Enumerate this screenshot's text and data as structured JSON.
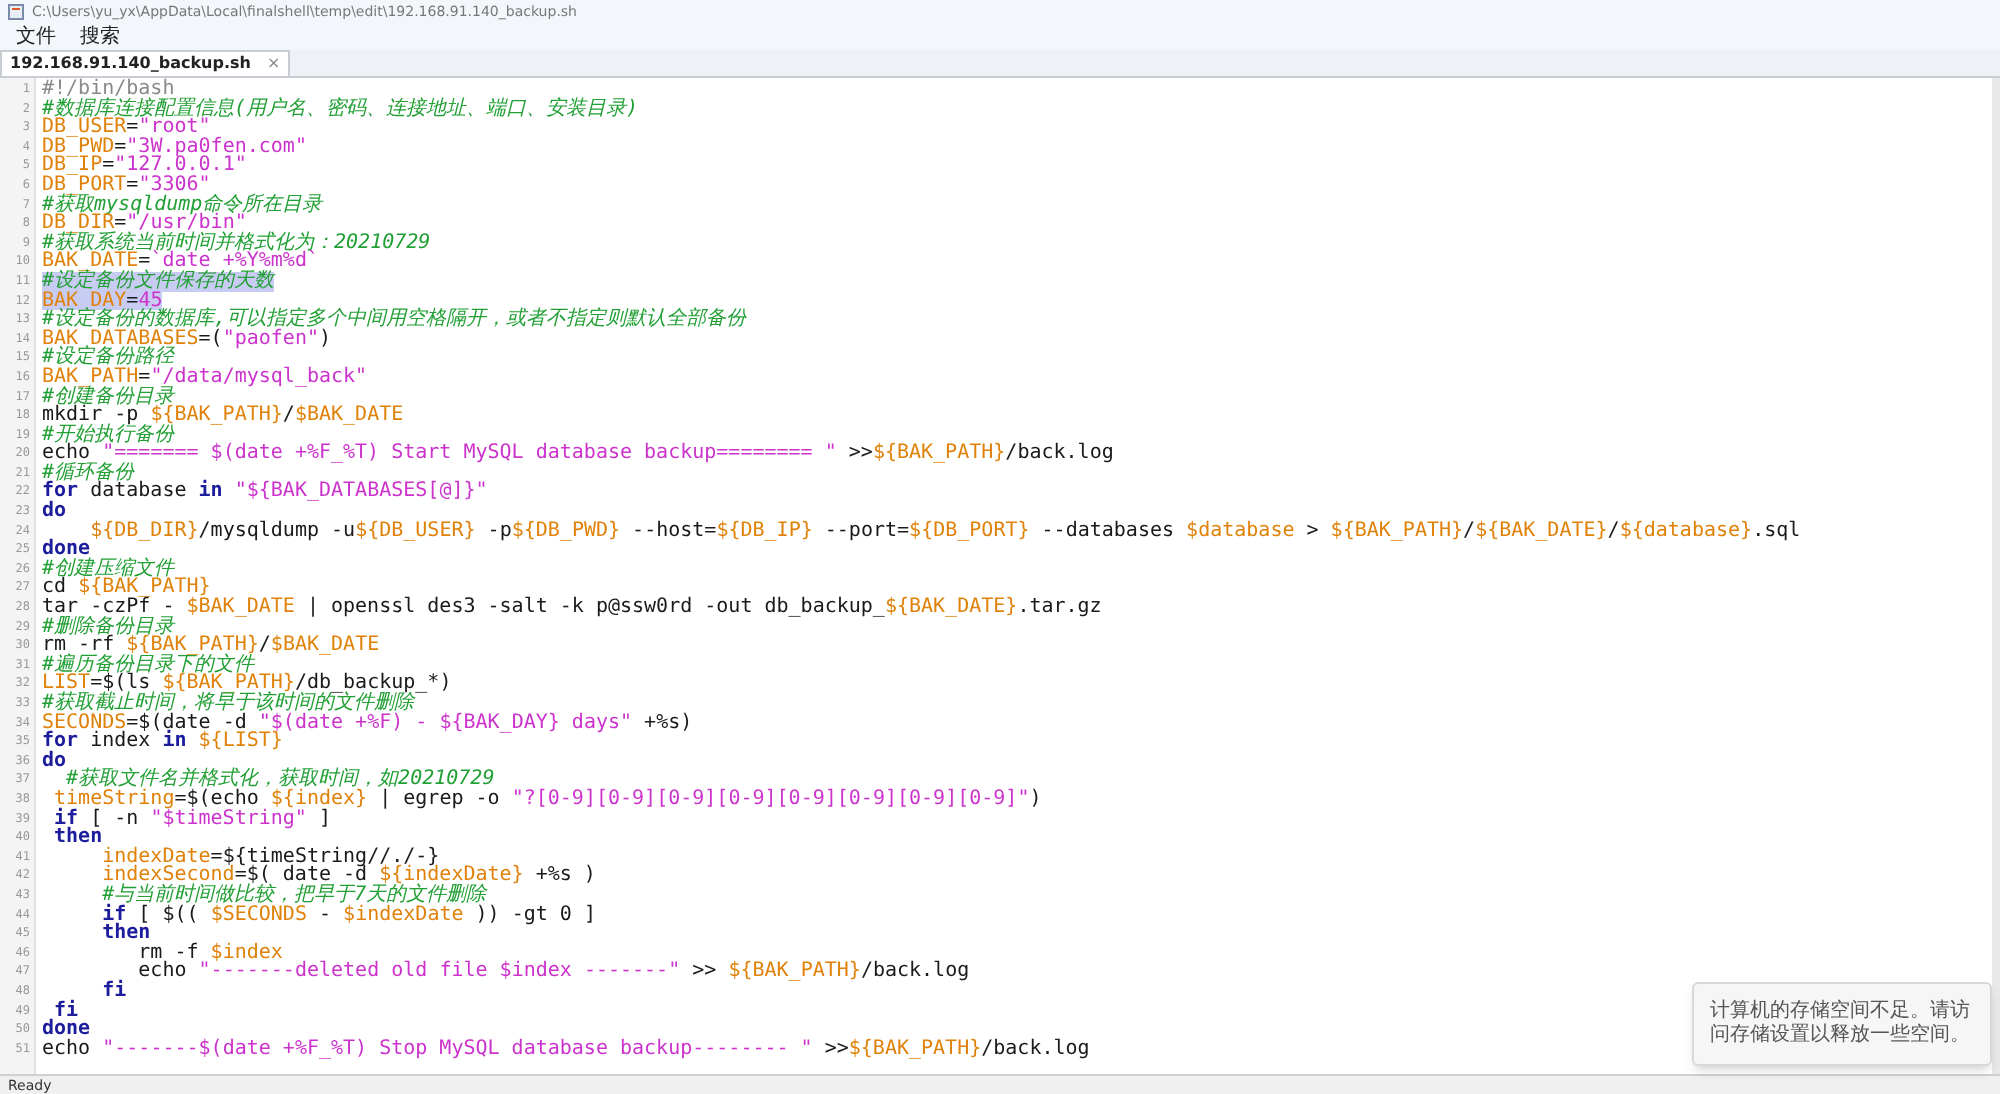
{
  "window": {
    "title": "C:\\Users\\yu_yx\\AppData\\Local\\finalshell\\temp\\edit\\192.168.91.140_backup.sh"
  },
  "menu": [
    {
      "label": "文件"
    },
    {
      "label": "搜索"
    }
  ],
  "tabs": [
    {
      "label": "192.168.91.140_backup.sh",
      "close": "×",
      "selected": true
    }
  ],
  "editor": {
    "lines": [
      {
        "number": "1",
        "selected": false,
        "tokens": [
          {
            "kind": "shebang",
            "text": "#!/bin/bash"
          }
        ]
      },
      {
        "number": "2",
        "selected": false,
        "tokens": [
          {
            "kind": "comment",
            "text": "#数据库连接配置信息(用户名、密码、连接地址、端口、安装目录)"
          }
        ]
      },
      {
        "number": "3",
        "selected": false,
        "tokens": [
          {
            "kind": "var",
            "text": "DB_USER"
          },
          {
            "kind": "plain",
            "text": "="
          },
          {
            "kind": "string",
            "text": "\"root\""
          }
        ]
      },
      {
        "number": "4",
        "selected": false,
        "tokens": [
          {
            "kind": "var",
            "text": "DB_PWD"
          },
          {
            "kind": "plain",
            "text": "="
          },
          {
            "kind": "string",
            "text": "\"3W.pa0fen.com\""
          }
        ]
      },
      {
        "number": "5",
        "selected": false,
        "tokens": [
          {
            "kind": "var",
            "text": "DB_IP"
          },
          {
            "kind": "plain",
            "text": "="
          },
          {
            "kind": "string",
            "text": "\"127.0.0.1\""
          }
        ]
      },
      {
        "number": "6",
        "selected": false,
        "tokens": [
          {
            "kind": "var",
            "text": "DB_PORT"
          },
          {
            "kind": "plain",
            "text": "="
          },
          {
            "kind": "string",
            "text": "\"3306\""
          }
        ]
      },
      {
        "number": "7",
        "selected": false,
        "tokens": [
          {
            "kind": "comment",
            "text": "#获取mysqldump命令所在目录"
          }
        ]
      },
      {
        "number": "8",
        "selected": false,
        "tokens": [
          {
            "kind": "var",
            "text": "DB_DIR"
          },
          {
            "kind": "plain",
            "text": "="
          },
          {
            "kind": "string",
            "text": "\"/usr/bin\""
          }
        ]
      },
      {
        "number": "9",
        "selected": false,
        "tokens": [
          {
            "kind": "comment",
            "text": "#获取系统当前时间并格式化为：20210729"
          }
        ]
      },
      {
        "number": "10",
        "selected": false,
        "tokens": [
          {
            "kind": "var",
            "text": "BAK_DATE"
          },
          {
            "kind": "plain",
            "text": "="
          },
          {
            "kind": "string",
            "text": "`date +%Y%m%d`"
          }
        ]
      },
      {
        "number": "11",
        "selected": true,
        "tokens": [
          {
            "kind": "comment",
            "text": "#设定备份文件保存的天数"
          }
        ]
      },
      {
        "number": "12",
        "selected": true,
        "tokens": [
          {
            "kind": "var",
            "text": "BAK_DAY"
          },
          {
            "kind": "plain",
            "text": "="
          },
          {
            "kind": "string",
            "text": "45"
          }
        ]
      },
      {
        "number": "13",
        "selected": false,
        "tokens": [
          {
            "kind": "comment",
            "text": "#设定备份的数据库,可以指定多个中间用空格隔开，或者不指定则默认全部备份"
          }
        ]
      },
      {
        "number": "14",
        "selected": false,
        "tokens": [
          {
            "kind": "var",
            "text": "BAK_DATABASES"
          },
          {
            "kind": "plain",
            "text": "=("
          },
          {
            "kind": "string",
            "text": "\"paofen\""
          },
          {
            "kind": "plain",
            "text": ")"
          }
        ]
      },
      {
        "number": "15",
        "selected": false,
        "tokens": [
          {
            "kind": "comment",
            "text": "#设定备份路径"
          }
        ]
      },
      {
        "number": "16",
        "selected": false,
        "tokens": [
          {
            "kind": "var",
            "text": "BAK_PATH"
          },
          {
            "kind": "plain",
            "text": "="
          },
          {
            "kind": "string",
            "text": "\"/data/mysql_back\""
          }
        ]
      },
      {
        "number": "17",
        "selected": false,
        "tokens": [
          {
            "kind": "comment",
            "text": "#创建备份目录"
          }
        ]
      },
      {
        "number": "18",
        "selected": false,
        "tokens": [
          {
            "kind": "plain",
            "text": "mkdir -p "
          },
          {
            "kind": "var",
            "text": "${BAK_PATH}"
          },
          {
            "kind": "plain",
            "text": "/"
          },
          {
            "kind": "var",
            "text": "$BAK_DATE"
          }
        ]
      },
      {
        "number": "19",
        "selected": false,
        "tokens": [
          {
            "kind": "comment",
            "text": "#开始执行备份"
          }
        ]
      },
      {
        "number": "20",
        "selected": false,
        "tokens": [
          {
            "kind": "plain",
            "text": "echo "
          },
          {
            "kind": "string",
            "text": "\"======= $(date +%F_%T) Start MySQL database backup======== \""
          },
          {
            "kind": "plain",
            "text": " >>"
          },
          {
            "kind": "var",
            "text": "${BAK_PATH}"
          },
          {
            "kind": "plain",
            "text": "/back.log"
          }
        ]
      },
      {
        "number": "21",
        "selected": false,
        "tokens": [
          {
            "kind": "comment",
            "text": "#循环备份"
          }
        ]
      },
      {
        "number": "22",
        "selected": false,
        "tokens": [
          {
            "kind": "keyword",
            "text": "for"
          },
          {
            "kind": "plain",
            "text": " database "
          },
          {
            "kind": "keyword",
            "text": "in"
          },
          {
            "kind": "string",
            "text": " \"${BAK_DATABASES[@]}\""
          }
        ]
      },
      {
        "number": "23",
        "selected": false,
        "tokens": [
          {
            "kind": "keyword",
            "text": "do"
          }
        ]
      },
      {
        "number": "24",
        "selected": false,
        "tokens": [
          {
            "kind": "var",
            "text": "    ${DB_DIR}"
          },
          {
            "kind": "plain",
            "text": "/mysqldump -u"
          },
          {
            "kind": "var",
            "text": "${DB_USER}"
          },
          {
            "kind": "plain",
            "text": " -p"
          },
          {
            "kind": "var",
            "text": "${DB_PWD}"
          },
          {
            "kind": "plain",
            "text": " --host="
          },
          {
            "kind": "var",
            "text": "${DB_IP}"
          },
          {
            "kind": "plain",
            "text": " --port="
          },
          {
            "kind": "var",
            "text": "${DB_PORT}"
          },
          {
            "kind": "plain",
            "text": " --databases "
          },
          {
            "kind": "var",
            "text": "$database"
          },
          {
            "kind": "plain",
            "text": " > "
          },
          {
            "kind": "var",
            "text": "${BAK_PATH}"
          },
          {
            "kind": "plain",
            "text": "/"
          },
          {
            "kind": "var",
            "text": "${BAK_DATE}"
          },
          {
            "kind": "plain",
            "text": "/"
          },
          {
            "kind": "var",
            "text": "${database}"
          },
          {
            "kind": "plain",
            "text": ".sql"
          }
        ]
      },
      {
        "number": "25",
        "selected": false,
        "tokens": [
          {
            "kind": "keyword",
            "text": "done"
          }
        ]
      },
      {
        "number": "26",
        "selected": false,
        "tokens": [
          {
            "kind": "comment",
            "text": "#创建压缩文件"
          }
        ]
      },
      {
        "number": "27",
        "selected": false,
        "tokens": [
          {
            "kind": "plain",
            "text": "cd "
          },
          {
            "kind": "var",
            "text": "${BAK_PATH}"
          }
        ]
      },
      {
        "number": "28",
        "selected": false,
        "tokens": [
          {
            "kind": "plain",
            "text": "tar -czPf - "
          },
          {
            "kind": "var",
            "text": "$BAK_DATE"
          },
          {
            "kind": "plain",
            "text": " | openssl des3 -salt -k p@ssw0rd -out db_backup_"
          },
          {
            "kind": "var",
            "text": "${BAK_DATE}"
          },
          {
            "kind": "plain",
            "text": ".tar.gz"
          }
        ]
      },
      {
        "number": "29",
        "selected": false,
        "tokens": [
          {
            "kind": "comment",
            "text": "#删除备份目录"
          }
        ]
      },
      {
        "number": "30",
        "selected": false,
        "tokens": [
          {
            "kind": "plain",
            "text": "rm -rf "
          },
          {
            "kind": "var",
            "text": "${BAK_PATH}"
          },
          {
            "kind": "plain",
            "text": "/"
          },
          {
            "kind": "var",
            "text": "$BAK_DATE"
          }
        ]
      },
      {
        "number": "31",
        "selected": false,
        "tokens": [
          {
            "kind": "comment",
            "text": "#遍历备份目录下的文件"
          }
        ]
      },
      {
        "number": "32",
        "selected": false,
        "tokens": [
          {
            "kind": "var",
            "text": "LIST"
          },
          {
            "kind": "plain",
            "text": "=$(ls "
          },
          {
            "kind": "var",
            "text": "${BAK_PATH}"
          },
          {
            "kind": "plain",
            "text": "/db_backup_*)"
          }
        ]
      },
      {
        "number": "33",
        "selected": false,
        "tokens": [
          {
            "kind": "comment",
            "text": "#获取截止时间，将早于该时间的文件删除"
          }
        ]
      },
      {
        "number": "34",
        "selected": false,
        "tokens": [
          {
            "kind": "var",
            "text": "SECONDS"
          },
          {
            "kind": "plain",
            "text": "=$(date -d "
          },
          {
            "kind": "string",
            "text": "\"$(date +%F) - ${BAK_DAY} days\""
          },
          {
            "kind": "plain",
            "text": " +%s)"
          }
        ]
      },
      {
        "number": "35",
        "selected": false,
        "tokens": [
          {
            "kind": "keyword",
            "text": "for"
          },
          {
            "kind": "plain",
            "text": " index "
          },
          {
            "kind": "keyword",
            "text": "in"
          },
          {
            "kind": "var",
            "text": " ${LIST}"
          }
        ]
      },
      {
        "number": "36",
        "selected": false,
        "tokens": [
          {
            "kind": "keyword",
            "text": "do"
          }
        ]
      },
      {
        "number": "37",
        "selected": false,
        "tokens": [
          {
            "kind": "comment",
            "text": "  #获取文件名并格式化，获取时间，如20210729"
          }
        ]
      },
      {
        "number": "38",
        "selected": false,
        "tokens": [
          {
            "kind": "var",
            "text": " timeString"
          },
          {
            "kind": "plain",
            "text": "=$(echo "
          },
          {
            "kind": "var",
            "text": "${index}"
          },
          {
            "kind": "plain",
            "text": " | egrep -o "
          },
          {
            "kind": "string",
            "text": "\"?[0-9][0-9][0-9][0-9][0-9][0-9][0-9][0-9]\""
          },
          {
            "kind": "plain",
            "text": ")"
          }
        ]
      },
      {
        "number": "39",
        "selected": false,
        "tokens": [
          {
            "kind": "keyword",
            "text": " if"
          },
          {
            "kind": "plain",
            "text": " [ -n "
          },
          {
            "kind": "string",
            "text": "\"$timeString\""
          },
          {
            "kind": "plain",
            "text": " ]"
          }
        ]
      },
      {
        "number": "40",
        "selected": false,
        "tokens": [
          {
            "kind": "keyword",
            "text": " then"
          }
        ]
      },
      {
        "number": "41",
        "selected": false,
        "tokens": [
          {
            "kind": "var",
            "text": "     indexDate"
          },
          {
            "kind": "plain",
            "text": "=${timeString//./-}"
          }
        ]
      },
      {
        "number": "42",
        "selected": false,
        "tokens": [
          {
            "kind": "var",
            "text": "     indexSecond"
          },
          {
            "kind": "plain",
            "text": "=$( date -d "
          },
          {
            "kind": "var",
            "text": "${indexDate}"
          },
          {
            "kind": "plain",
            "text": " +%s )"
          }
        ]
      },
      {
        "number": "43",
        "selected": false,
        "tokens": [
          {
            "kind": "comment",
            "text": "     #与当前时间做比较，把早于7天的文件删除"
          }
        ]
      },
      {
        "number": "44",
        "selected": false,
        "tokens": [
          {
            "kind": "keyword",
            "text": "     if"
          },
          {
            "kind": "plain",
            "text": " [ $(( "
          },
          {
            "kind": "var",
            "text": "$SECONDS"
          },
          {
            "kind": "plain",
            "text": " - "
          },
          {
            "kind": "var",
            "text": "$indexDate"
          },
          {
            "kind": "plain",
            "text": " )) -gt 0 ]"
          }
        ]
      },
      {
        "number": "45",
        "selected": false,
        "tokens": [
          {
            "kind": "keyword",
            "text": "     then"
          }
        ]
      },
      {
        "number": "46",
        "selected": false,
        "tokens": [
          {
            "kind": "plain",
            "text": "        rm -f "
          },
          {
            "kind": "var",
            "text": "$index"
          }
        ]
      },
      {
        "number": "47",
        "selected": false,
        "tokens": [
          {
            "kind": "plain",
            "text": "        echo "
          },
          {
            "kind": "string",
            "text": "\"-------deleted old file $index -------\""
          },
          {
            "kind": "plain",
            "text": " >> "
          },
          {
            "kind": "var",
            "text": "${BAK_PATH}"
          },
          {
            "kind": "plain",
            "text": "/back.log"
          }
        ]
      },
      {
        "number": "48",
        "selected": false,
        "tokens": [
          {
            "kind": "keyword",
            "text": "     fi"
          }
        ]
      },
      {
        "number": "49",
        "selected": false,
        "tokens": [
          {
            "kind": "keyword",
            "text": " fi"
          }
        ]
      },
      {
        "number": "50",
        "selected": false,
        "tokens": [
          {
            "kind": "keyword",
            "text": "done"
          }
        ]
      },
      {
        "number": "51",
        "selected": false,
        "tokens": [
          {
            "kind": "plain",
            "text": "echo "
          },
          {
            "kind": "string",
            "text": "\"-------$(date +%F_%T) Stop MySQL database backup-------- \""
          },
          {
            "kind": "plain",
            "text": " >>"
          },
          {
            "kind": "var",
            "text": "${BAK_PATH}"
          },
          {
            "kind": "plain",
            "text": "/back.log"
          }
        ]
      }
    ]
  },
  "status_bar": "Ready",
  "notification": {
    "body": "计算机的存储空间不足。请访问存储设置以释放一些空间。"
  }
}
